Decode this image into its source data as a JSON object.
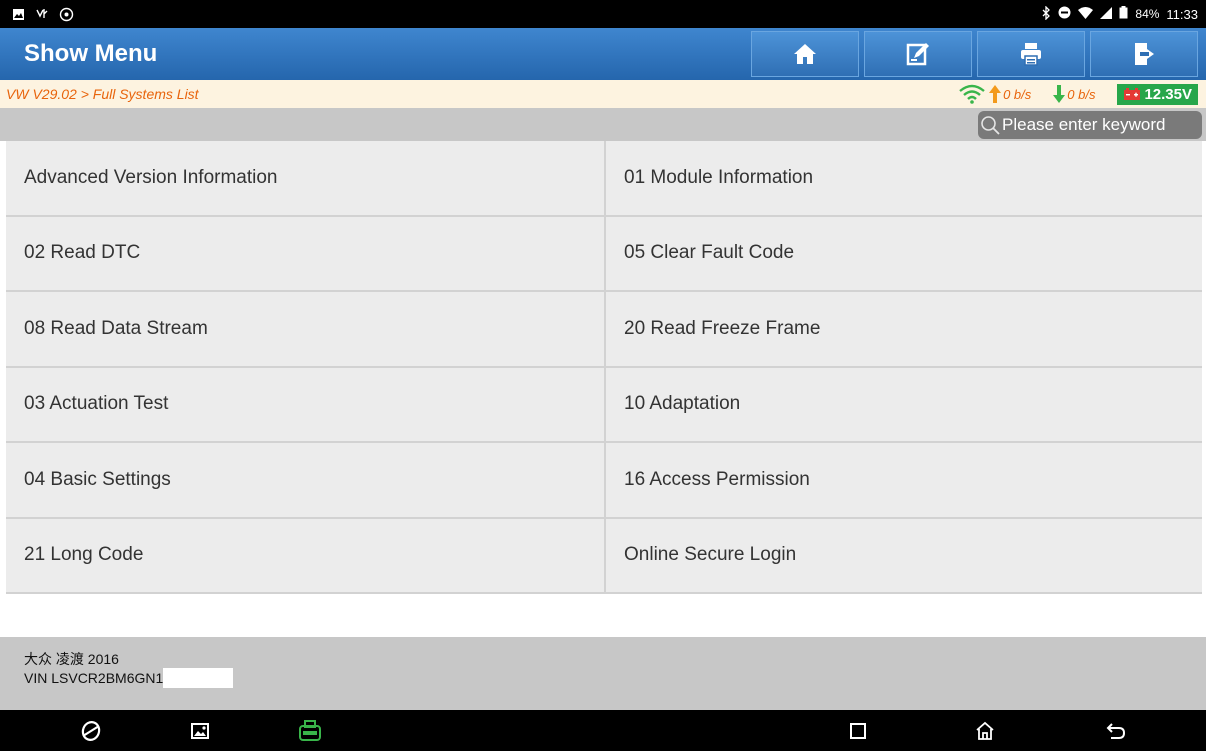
{
  "status_bar": {
    "battery": "84%",
    "time": "11:33",
    "icons": [
      "image-icon",
      "usb-icon",
      "settings-icon",
      "bluetooth-icon",
      "dnd-icon",
      "wifi-icon",
      "signal-icon",
      "battery-icon"
    ]
  },
  "header": {
    "title": "Show Menu",
    "buttons": [
      "home-icon",
      "edit-icon",
      "print-icon",
      "exit-icon"
    ]
  },
  "breadcrumb": {
    "path": "VW V29.02 > Full Systems List",
    "upload_speed": "0 b/s",
    "download_speed": "0 b/s",
    "voltage": "12.35V"
  },
  "search": {
    "placeholder": "Please enter keyword"
  },
  "menu": {
    "items": [
      "Advanced Version Information",
      "01 Module Information",
      "02 Read DTC",
      "05 Clear Fault Code",
      "08 Read Data Stream",
      "20 Read Freeze Frame",
      "03 Actuation Test",
      "10 Adaptation",
      "04 Basic Settings",
      "16 Access Permission",
      "21 Long Code",
      "Online Secure Login"
    ]
  },
  "vehicle": {
    "model": "大众 凌渡 2016",
    "vin": "VIN LSVCR2BM6GN1"
  },
  "colors": {
    "header": "#2f72b8",
    "breadcrumb_text": "#e8640c",
    "voltage_bg": "#27a64a",
    "menu_cell": "#ececec"
  }
}
